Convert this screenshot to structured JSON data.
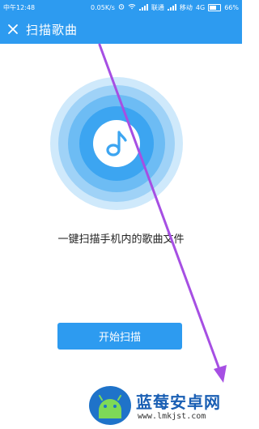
{
  "status_bar": {
    "time": "中午12:48",
    "speed": "0.05K/s",
    "carrier1": "联通",
    "carrier2": "移动",
    "network": "4G",
    "battery": "66%",
    "battery_level": 0.66
  },
  "app_bar": {
    "title": "扫描歌曲",
    "close_icon": "close-icon"
  },
  "main": {
    "graphic_icon": "music-note-icon",
    "scan_text": "一键扫描手机内的歌曲文件",
    "start_button": "开始扫描"
  },
  "watermark": {
    "title": "蓝莓安卓网",
    "url": "www.lmkjst.com"
  },
  "colors": {
    "primary": "#2d9bf0",
    "ring_outer": "#cfe9fb",
    "ring_inner": "#3ca5f1",
    "annotation_arrow": "#a64fe3"
  }
}
